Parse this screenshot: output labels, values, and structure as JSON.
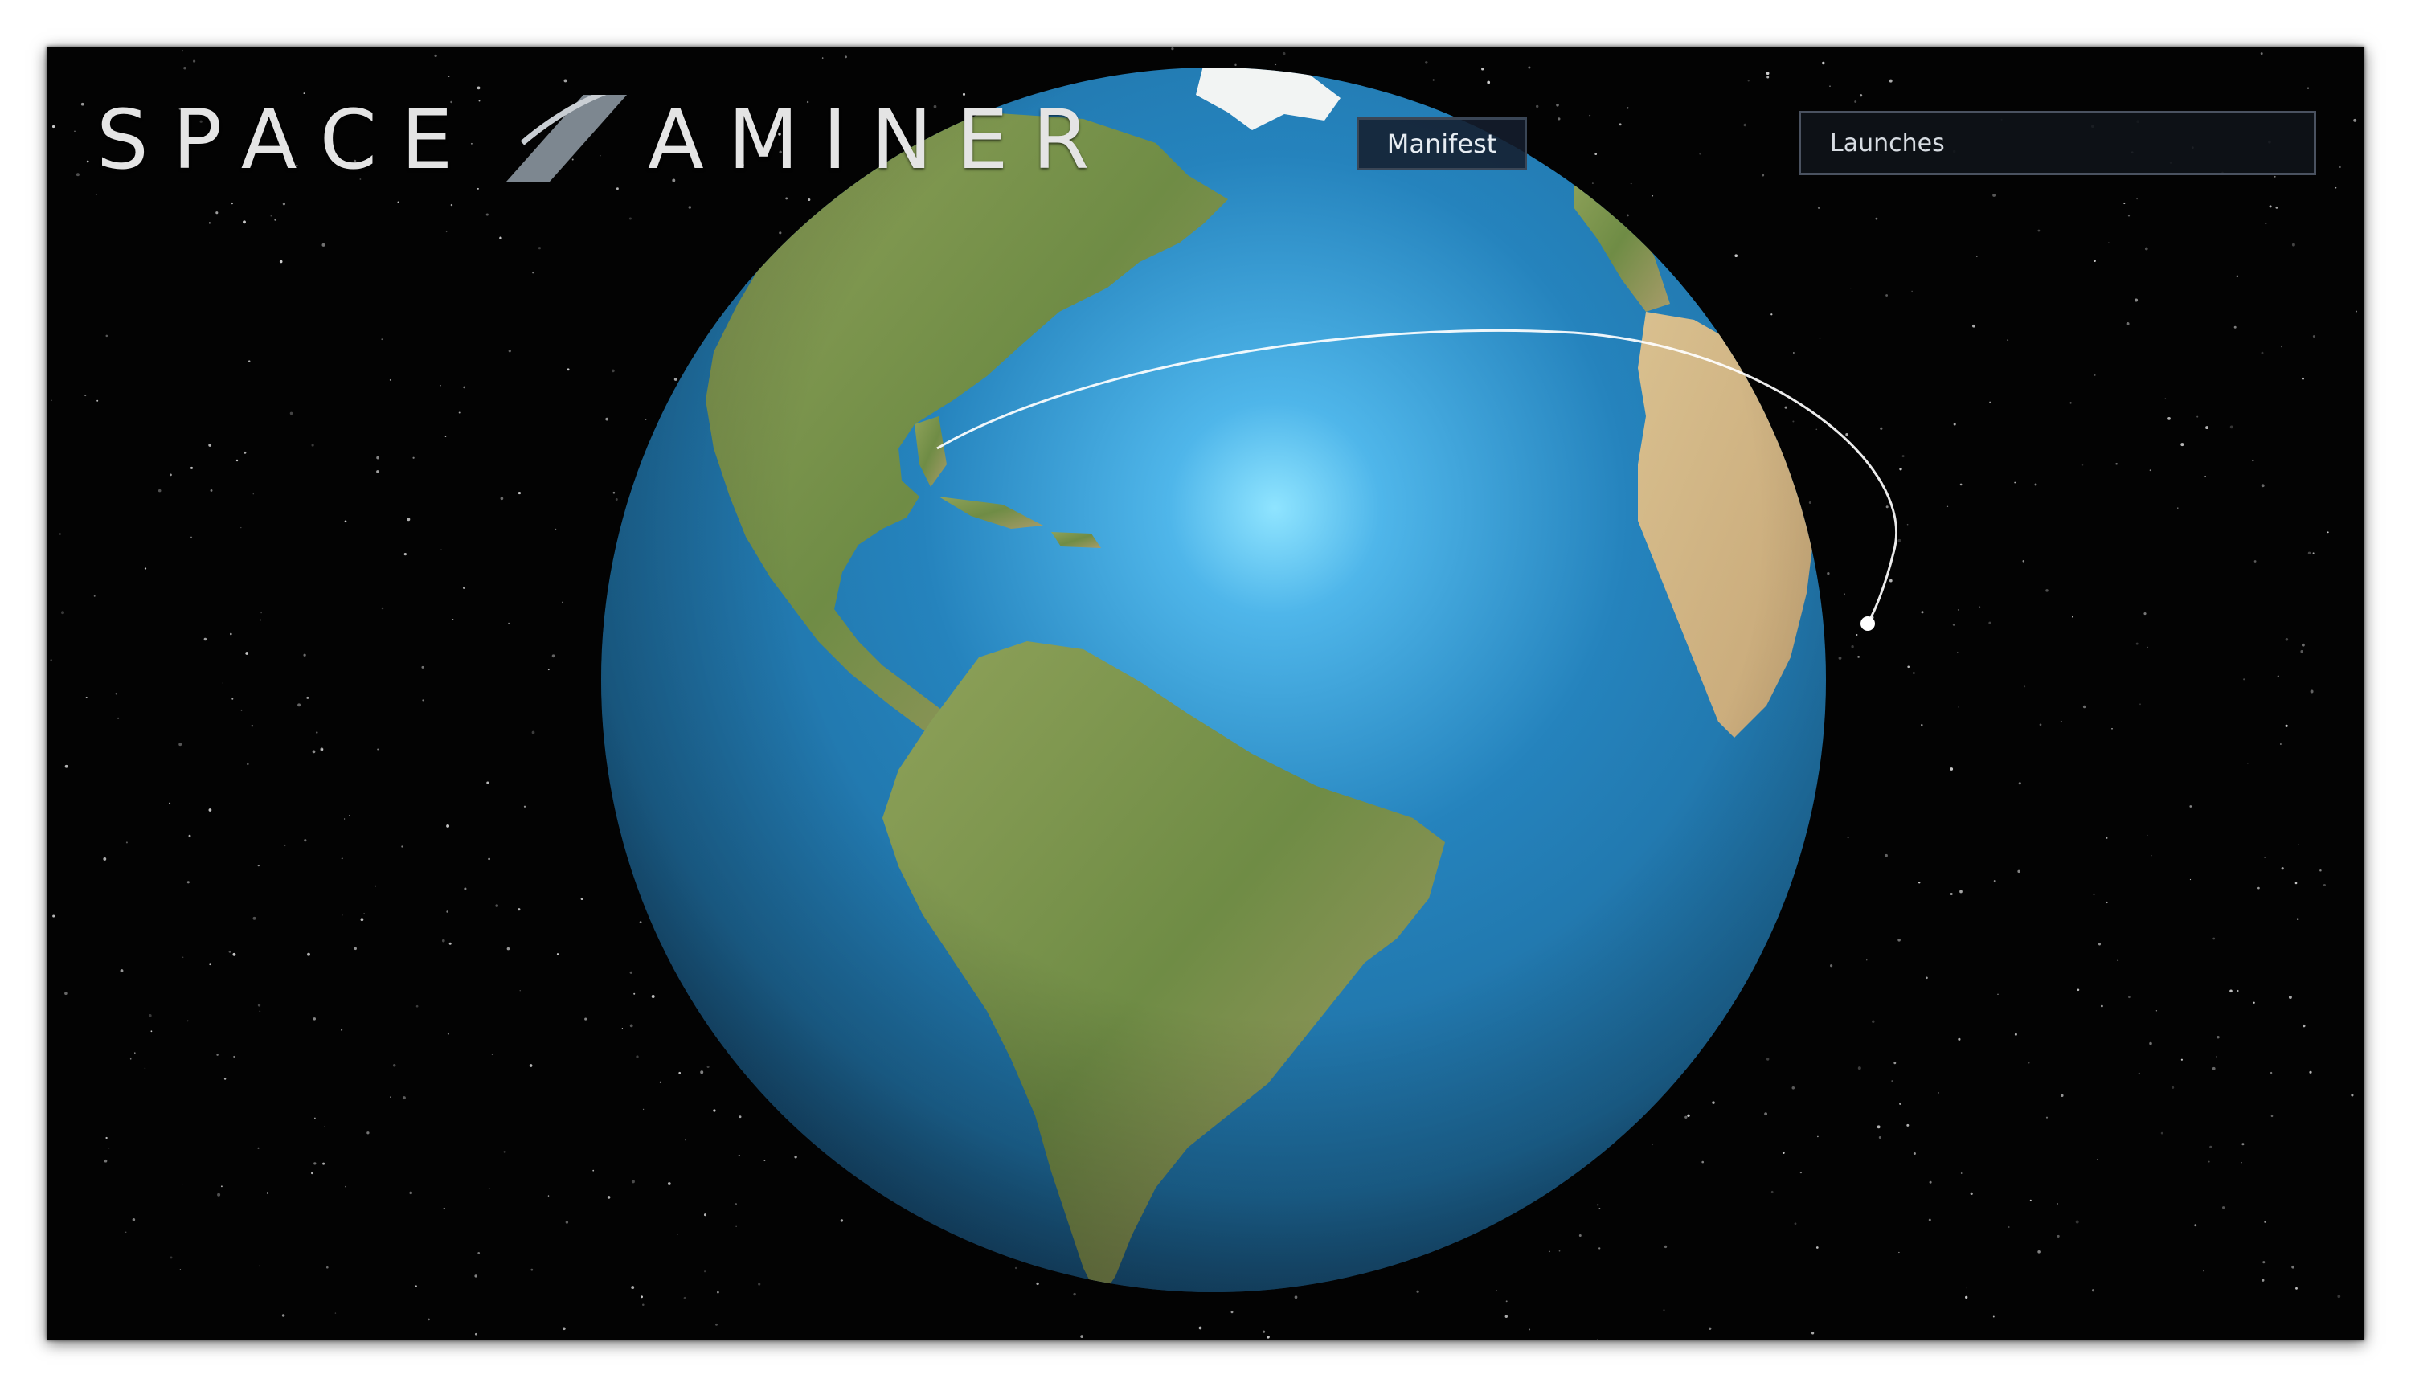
{
  "app": {
    "logo": {
      "text_left": "SPACE",
      "text_right": "AMINER",
      "accent_color": "#e4e4e4"
    }
  },
  "toolbar": {
    "manifest_label": "Manifest",
    "launches_label": "Launches"
  },
  "scene": {
    "globe": "earth-globe",
    "trajectory": "launch-trajectory-arc",
    "marker": "payload-marker"
  },
  "colors": {
    "background": "#030303",
    "ocean": "#2f7fb6",
    "button_bg": "#141e2d",
    "trajectory": "#ffffff"
  }
}
